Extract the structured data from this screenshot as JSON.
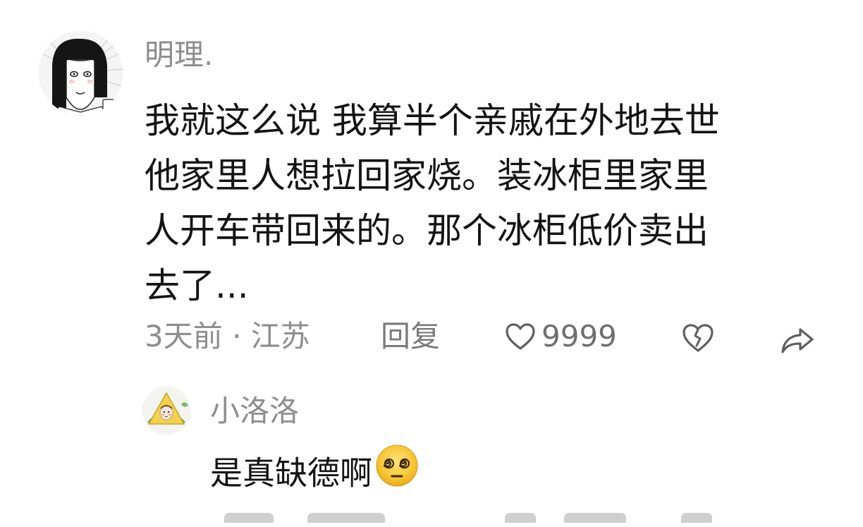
{
  "comment": {
    "username": "明理.",
    "body_lines": [
      "我就这么说 我算半个亲戚在外地去世",
      "他家里人想拉回家烧。装冰柜里家里",
      "人开车带回来的。那个冰柜低价卖出",
      "去了..."
    ],
    "time_location": "3天前 · 江苏",
    "reply_label": "回复",
    "like_count": "9999",
    "avatar_icon": "cartoon-girl-avatar",
    "like_icon": "heart-outline-icon",
    "dislike_icon": "broken-heart-icon",
    "share_icon": "share-arrow-icon"
  },
  "reply": {
    "username": "小洛洛",
    "text": "是真缺德啊",
    "emoji_icon": "dizzy-face-emoji",
    "avatar_icon": "rice-dumpling-avatar"
  },
  "colors": {
    "text_primary": "#141414",
    "text_secondary": "#8d8d8d",
    "background": "#ffffff",
    "emoji_yellow": "#f7c531"
  }
}
